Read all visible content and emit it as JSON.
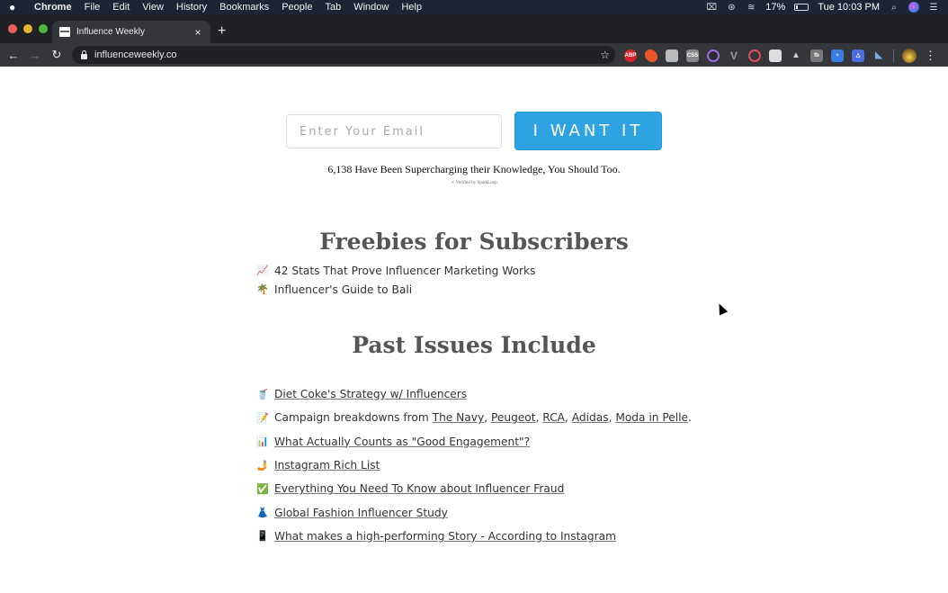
{
  "menubar": {
    "apple": "",
    "items": [
      "Chrome",
      "File",
      "Edit",
      "View",
      "History",
      "Bookmarks",
      "People",
      "Tab",
      "Window",
      "Help"
    ],
    "battery_percent": "17%",
    "clock": "Tue 10:03 PM"
  },
  "browser": {
    "tab_title": "Influence Weekly",
    "tab_close": "×",
    "new_tab": "+",
    "back": "←",
    "forward": "→",
    "reload": "↻",
    "url": "influenceweekly.co",
    "bookmark_star": "☆",
    "extensions": [
      "ABP",
      "fox",
      "translate",
      "CSS",
      "mic",
      "vue",
      "spiral",
      "square",
      "fire",
      "fb",
      "star-plus",
      "triangle",
      "bird"
    ],
    "menu": "⋮"
  },
  "signup": {
    "email_placeholder": "Enter Your Email",
    "email_value": "",
    "cta_label": "I WANT IT",
    "social_proof": "6,138 Have Been Supercharging their Knowledge, You Should Too.",
    "verified": "✓ Verified by SparkLoop"
  },
  "freebies": {
    "title": "Freebies for Subscribers",
    "items": [
      {
        "emoji": "📈",
        "text": "42 Stats That Prove Influencer Marketing Works"
      },
      {
        "emoji": "🌴",
        "text": "Influencer's Guide to Bali"
      }
    ]
  },
  "past_issues": {
    "title": "Past Issues Include",
    "items": [
      {
        "emoji": "🥤",
        "link": "Diet Coke's Strategy w/ Influencers"
      },
      {
        "emoji": "📝",
        "prefix": "Campaign breakdowns from ",
        "links": [
          "The Navy",
          "Peugeot",
          "RCA",
          "Adidas",
          "Moda in Pelle"
        ],
        "sep": ", ",
        "suffix": "."
      },
      {
        "emoji": "📊",
        "link": "What Actually Counts as \"Good Engagement\"?"
      },
      {
        "emoji": "🤳",
        "link": "Instagram Rich List"
      },
      {
        "emoji": "✅",
        "link": "Everything You Need To Know about Influencer Fraud"
      },
      {
        "emoji": "👗",
        "link": "Global Fashion Influencer Study"
      },
      {
        "emoji": "📱",
        "link": "What makes a high-performing Story - According to Instagram"
      }
    ]
  }
}
